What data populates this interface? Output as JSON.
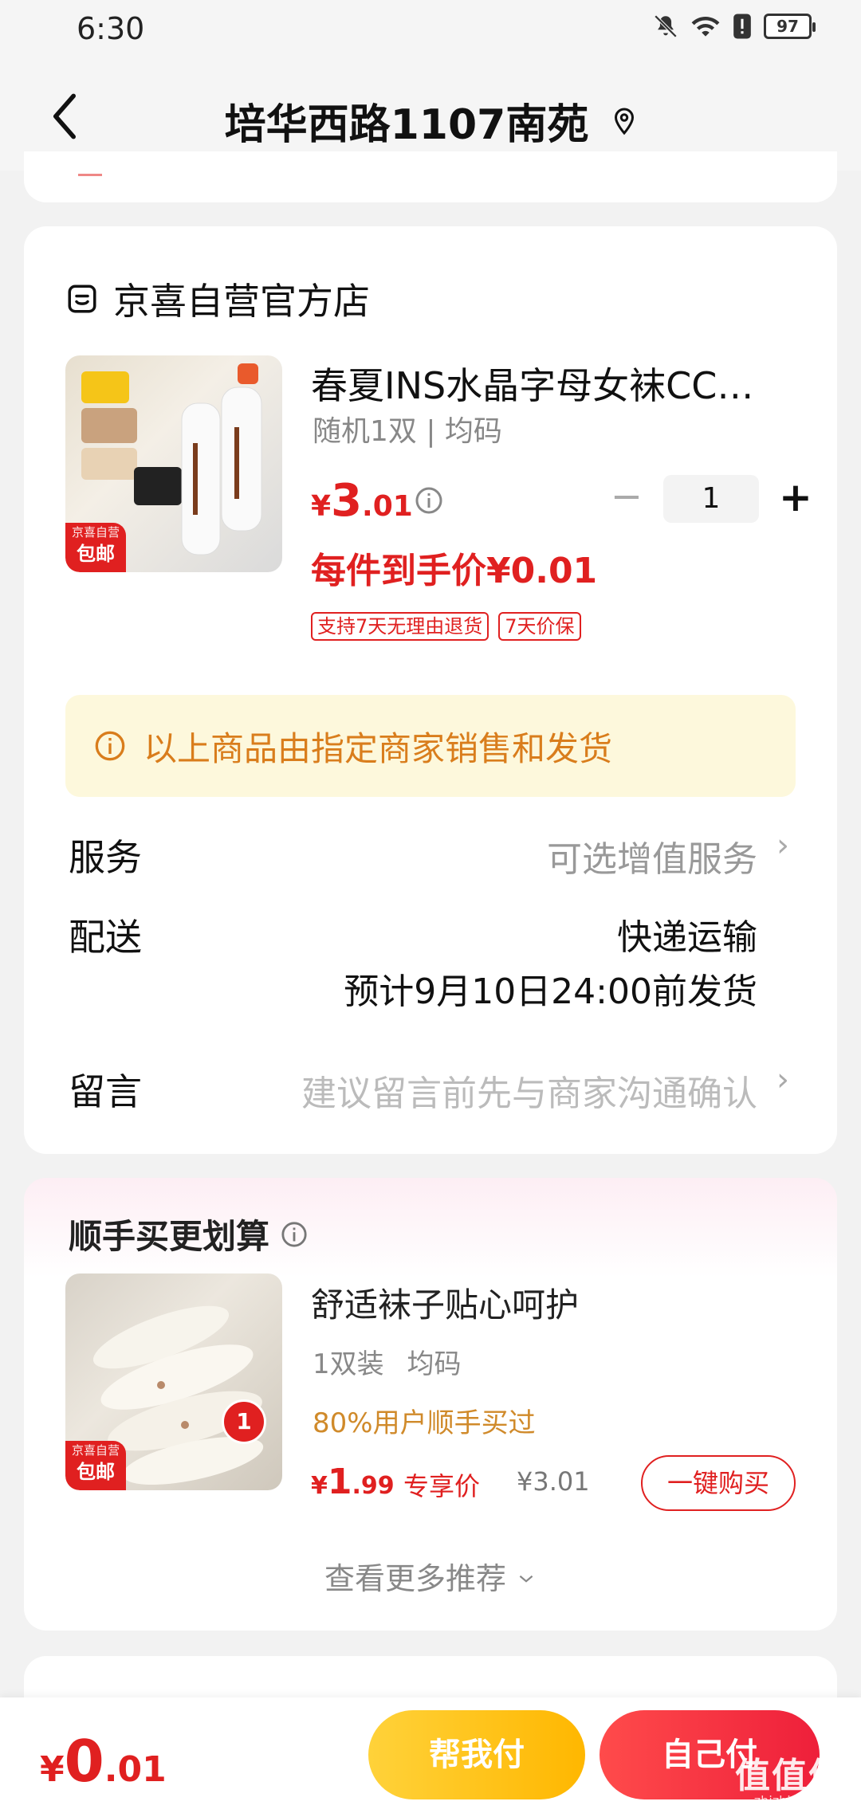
{
  "status_bar": {
    "time": "6:30",
    "battery": "97"
  },
  "header": {
    "title": "培华西路1107南苑"
  },
  "store": {
    "name": "京喜自营官方店"
  },
  "product": {
    "title": "春夏INS水晶字母女袜CC…",
    "spec": "随机1双 | 均码",
    "price_symbol": "¥",
    "price_int": "3",
    "price_dec": ".01",
    "quantity": "1",
    "minus": "−",
    "plus": "+",
    "promo_price": "每件到手价¥0.01",
    "badges": [
      "支持7天无理由退货",
      "7天价保"
    ],
    "tag_top": "京喜自营",
    "tag_bottom": "包邮"
  },
  "notice": {
    "text": "以上商品由指定商家销售和发货"
  },
  "service": {
    "label": "服务",
    "value": "可选增值服务"
  },
  "shipping": {
    "label": "配送",
    "method": "快递运输",
    "estimate": "预计9月10日24:00前发货"
  },
  "message": {
    "label": "留言",
    "placeholder": "建议留言前先与商家沟通确认"
  },
  "recommend": {
    "title": "顺手买更划算",
    "item_name": "舒适袜子贴心呵护",
    "item_spec": "1双装 均码",
    "item_bought": "80%用户顺手买过",
    "price_symbol": "¥",
    "price_int": "1",
    "price_dec": ".99",
    "exclusive_label": "专享价",
    "orig_price": "¥3.01",
    "buy_label": "一键购买",
    "more_label": "查看更多推荐",
    "pair_badge": "1",
    "tag_top": "京喜自营",
    "tag_bottom": "包邮"
  },
  "bottom": {
    "total_symbol": "¥",
    "total_int": "0",
    "total_dec": ".01",
    "help_pay": "帮我付",
    "self_pay": "自己付"
  },
  "watermark": {
    "text": "值值值",
    "sub": "zhizhizhi.com"
  },
  "colors": {
    "accent": "#e02020",
    "notice_bg": "#fdf8dc",
    "notice_text": "#d97d1c",
    "yellow_btn": "#ffc21a"
  }
}
